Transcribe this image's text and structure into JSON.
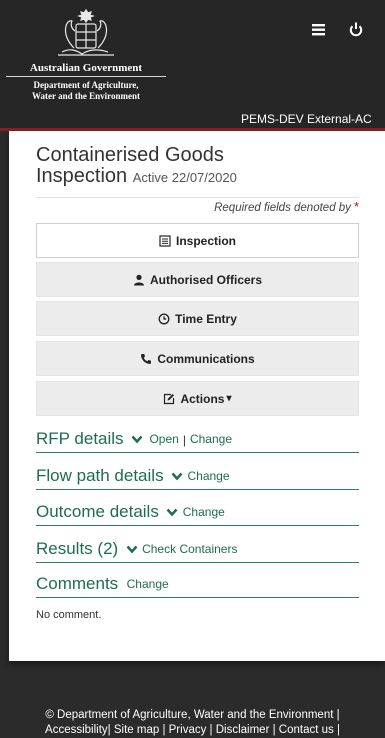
{
  "header": {
    "gov_title": "Australian Government",
    "dept_name_line1": "Department of Agriculture,",
    "dept_name_line2": "Water and the Environment",
    "env_label": "PEMS-DEV External-AC",
    "menu_icon": "hamburger-icon",
    "power_icon": "power-icon"
  },
  "page": {
    "title_line1": "Containerised Goods",
    "title_line2": "Inspection",
    "status": "Active 22/07/2020",
    "required_text": "Required fields denoted by",
    "required_mark": "*"
  },
  "menu": [
    {
      "label": "Inspection",
      "icon": "list-icon"
    },
    {
      "label": "Authorised Officers",
      "icon": "user-icon"
    },
    {
      "label": "Time Entry",
      "icon": "clock-icon"
    },
    {
      "label": "Communications",
      "icon": "phone-icon"
    },
    {
      "label": "Actions",
      "icon": "edit-icon",
      "caret": "▾"
    }
  ],
  "sections": {
    "rfp": {
      "title": "RFP details",
      "link1": "Open",
      "sep": "|",
      "link2": "Change"
    },
    "flow": {
      "title": "Flow path details",
      "link": "Change"
    },
    "outcome": {
      "title": "Outcome details",
      "link": "Change"
    },
    "results": {
      "title": "Results (2)",
      "link": "Check Containers"
    },
    "comments": {
      "title": "Comments",
      "link": "Change",
      "empty": "No comment."
    }
  },
  "footer": {
    "line1": "© Department of Agriculture, Water and the Environment |",
    "links": [
      "Accessibility",
      "Site map",
      "Privacy",
      "Disclaimer",
      "Contact us"
    ]
  },
  "colors": {
    "accent": "#1f6b55",
    "header_bg": "#262626",
    "header_border": "#8b1d22",
    "required": "#d0021b"
  }
}
